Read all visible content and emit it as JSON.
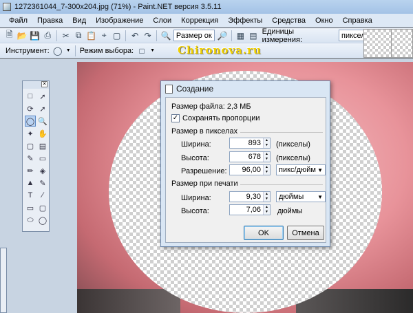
{
  "window": {
    "title": "1272361044_7-300x204.jpg (71%) - Paint.NET версия 3.5.11"
  },
  "menu": [
    "Файл",
    "Правка",
    "Вид",
    "Изображение",
    "Слои",
    "Коррекция",
    "Эффекты",
    "Средства",
    "Окно",
    "Справка"
  ],
  "toolbar": {
    "zoom_value": "Размер ок",
    "units_label": "Единицы измерения:",
    "units_value": "пикселы",
    "tool_label": "Инструмент:",
    "selection_mode_label": "Режим выбора:"
  },
  "watermark": "Chironova.ru",
  "dialog": {
    "title": "Создание",
    "file_size": "Размер файла: 2,3 МБ",
    "keep_proportions": "Сохранять пропорции",
    "keep_proportions_checked": true,
    "pixel_size_group": "Размер в пикселах",
    "print_size_group": "Размер при печати",
    "width_label": "Ширина:",
    "height_label": "Высота:",
    "resolution_label": "Разрешение:",
    "pixel_width": "893",
    "pixel_height": "678",
    "resolution": "96,00",
    "pixels_unit": "(пикселы)",
    "resolution_unit": "пикс/дюйм",
    "print_width": "9,30",
    "print_height": "7,06",
    "print_unit_dropdown": "дюймы",
    "print_unit_text": "дюймы",
    "ok_label": "OK",
    "cancel_label": "Отмена"
  }
}
